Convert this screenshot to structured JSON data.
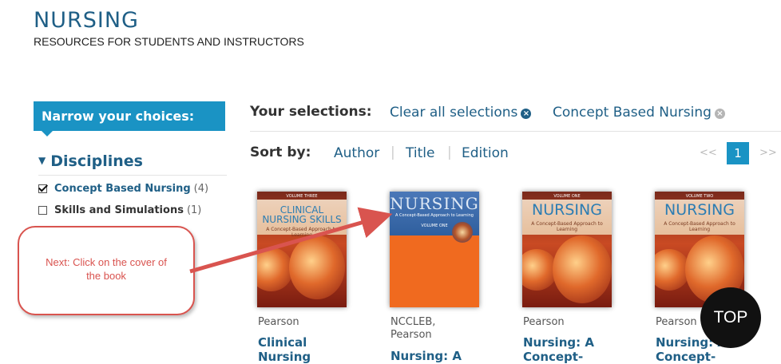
{
  "header": {
    "title": "NURSING",
    "subtitle": "RESOURCES FOR STUDENTS AND INSTRUCTORS"
  },
  "sidebar": {
    "narrow_label": "Narrow your choices:",
    "disciplines_label": "Disciplines",
    "filters": [
      {
        "label": "Concept Based Nursing",
        "count": "(4)",
        "checked": true
      },
      {
        "label": "Skills and Simulations",
        "count": "(1)",
        "checked": false
      }
    ]
  },
  "selections": {
    "label": "Your selections:",
    "clear_all": "Clear all selections",
    "active": "Concept Based Nursing"
  },
  "sort": {
    "label": "Sort by:",
    "options": [
      "Author",
      "Title",
      "Edition"
    ]
  },
  "pager": {
    "prev": "<<",
    "current": "1",
    "next": ">>"
  },
  "books": [
    {
      "publisher": "Pearson",
      "title_lines": [
        "Clinical",
        "Nursing"
      ],
      "cover": {
        "volume": "VOLUME THREE",
        "title": "CLINICAL NURSING SKILLS",
        "subtitle": "A Concept-Based Approach to Learning"
      }
    },
    {
      "publisher_lines": [
        "NCCLEB,",
        "Pearson"
      ],
      "title_lines": [
        "Nursing: A"
      ],
      "cover": {
        "title": "NURSING",
        "subtitle": "A Concept-Based Approach to Learning",
        "volume": "VOLUME ONE"
      }
    },
    {
      "publisher": "Pearson",
      "title_lines": [
        "Nursing: A",
        "Concept-"
      ],
      "cover": {
        "volume": "VOLUME ONE",
        "title": "NURSING",
        "subtitle": "A Concept-Based Approach to Learning"
      }
    },
    {
      "publisher": "Pearson",
      "title_lines": [
        "Nursing: A",
        "Concept-"
      ],
      "cover": {
        "volume": "VOLUME TWO",
        "title": "NURSING",
        "subtitle": "A Concept-Based Approach to Learning"
      }
    }
  ],
  "callout": {
    "line1": "Next: Click on the cover of",
    "line2": "the book"
  },
  "top_button": "TOP",
  "colors": {
    "brand_blue": "#1f5f86",
    "accent_blue": "#1a93c4",
    "callout_red": "#d9544f"
  }
}
